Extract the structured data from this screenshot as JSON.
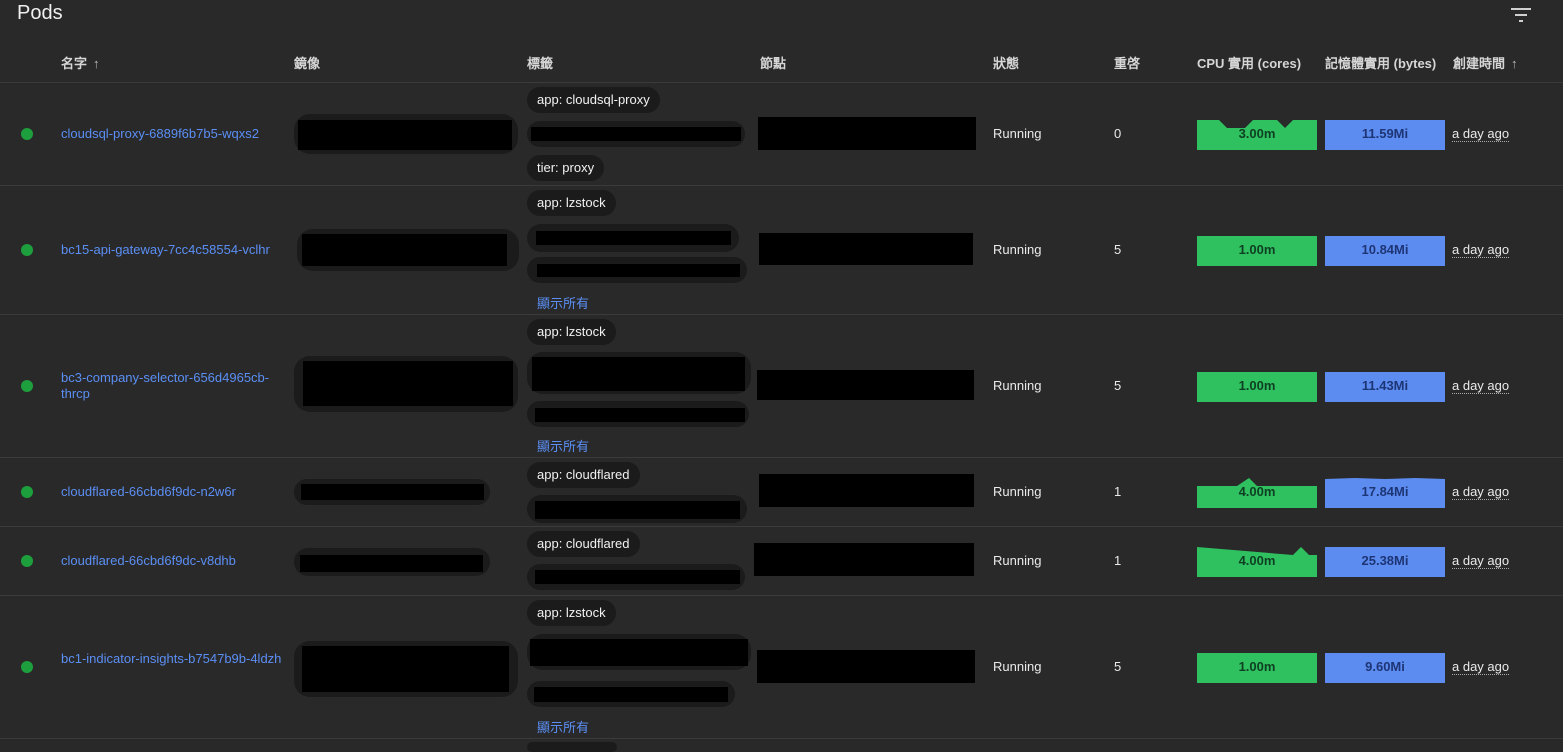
{
  "header": {
    "title": "Pods"
  },
  "columns": {
    "name": "名字",
    "image": "鏡像",
    "labels": "標籤",
    "node": "節點",
    "status": "狀態",
    "restarts": "重啓",
    "cpu": "CPU 實用 (cores)",
    "memory": "記憶體實用 (bytes)",
    "created": "創建時間"
  },
  "sort_arrow": "↑",
  "rows": [
    {
      "name": "cloudsql-proxy-6889f6b7b5-wqxs2",
      "labels": [
        "app: cloudsql-proxy",
        "tier: proxy"
      ],
      "status": "Running",
      "restarts": "0",
      "cpu": "3.00m",
      "memory": "11.59Mi",
      "created": "a day ago"
    },
    {
      "name": "bc15-api-gateway-7cc4c58554-vclhr",
      "labels": [
        "app: lzstock"
      ],
      "show_all": "顯示所有",
      "status": "Running",
      "restarts": "5",
      "cpu": "1.00m",
      "memory": "10.84Mi",
      "created": "a day ago"
    },
    {
      "name": "bc3-company-selector-656d4965cb-thrcp",
      "labels": [
        "app: lzstock"
      ],
      "show_all": "顯示所有",
      "status": "Running",
      "restarts": "5",
      "cpu": "1.00m",
      "memory": "11.43Mi",
      "created": "a day ago"
    },
    {
      "name": "cloudflared-66cbd6f9dc-n2w6r",
      "labels": [
        "app: cloudflared"
      ],
      "status": "Running",
      "restarts": "1",
      "cpu": "4.00m",
      "memory": "17.84Mi",
      "created": "a day ago"
    },
    {
      "name": "cloudflared-66cbd6f9dc-v8dhb",
      "labels": [
        "app: cloudflared"
      ],
      "status": "Running",
      "restarts": "1",
      "cpu": "4.00m",
      "memory": "25.38Mi",
      "created": "a day ago"
    },
    {
      "name": "bc1-indicator-insights-b7547b9b-4ldzh",
      "labels": [
        "app: lzstock"
      ],
      "show_all": "顯示所有",
      "status": "Running",
      "restarts": "5",
      "cpu": "1.00m",
      "memory": "9.60Mi",
      "created": "a day ago"
    }
  ],
  "colors": {
    "cpu": "#2fc160",
    "memory": "#5d8cf0",
    "link": "#5b8ff5",
    "running_dot": "#1e9f3d"
  },
  "icons": {
    "filter": "filter-icon",
    "sort": "arrow-up-icon"
  }
}
